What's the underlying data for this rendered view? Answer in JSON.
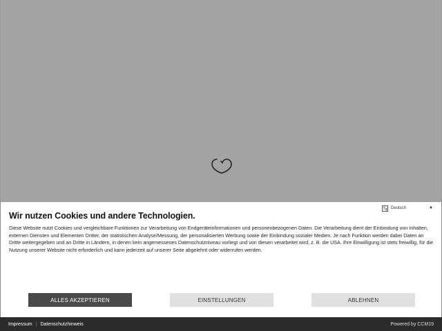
{
  "cookie_banner": {
    "language": "Deutsch",
    "title": "Wir nutzen Cookies und andere Technologien.",
    "text": "Diese Website nutzt Cookies und vergleichbare Funktionen zur Verarbeitung von Endgeräteinformationen und personenbezogenen Daten. Die Verarbeitung dient der Einbindung von Inhalten, externen Diensten und Elementen Dritter, der statistischen Analyse/Messung, der personalisierten Werbung sowie der Einbindung sozialer Medien. Je nach Funktion werden dabei Daten an Dritte weitergegeben und an Dritte in Ländern, in denen kein angemessenes Datenschutzniveau vorliegt und von diesen verarbeitet wird, z. B. die USA. Ihre Einwilligung ist stets freiwillig, für die Nutzung unserer Website nicht erforderlich und kann jederzeit auf unserer Seite abgelehnt oder widerrufen werden.",
    "buttons": {
      "accept": "ALLES AKZEPTIEREN",
      "settings": "EINSTELLUNGEN",
      "reject": "ABLEHNEN"
    }
  },
  "footer": {
    "imprint": "Impressum",
    "privacy": "Datenschutzhinweis",
    "powered_by": "Powered by CCM19"
  },
  "colors": {
    "backdrop": "#a3a3a3",
    "accept_button": "#4a4a4a",
    "secondary_button": "#e0e0e0",
    "footer": "#2b2b2b"
  },
  "icons": {
    "loader": "heart-logo-icon",
    "language": "globe-icon",
    "dropdown": "caret-down-icon"
  }
}
